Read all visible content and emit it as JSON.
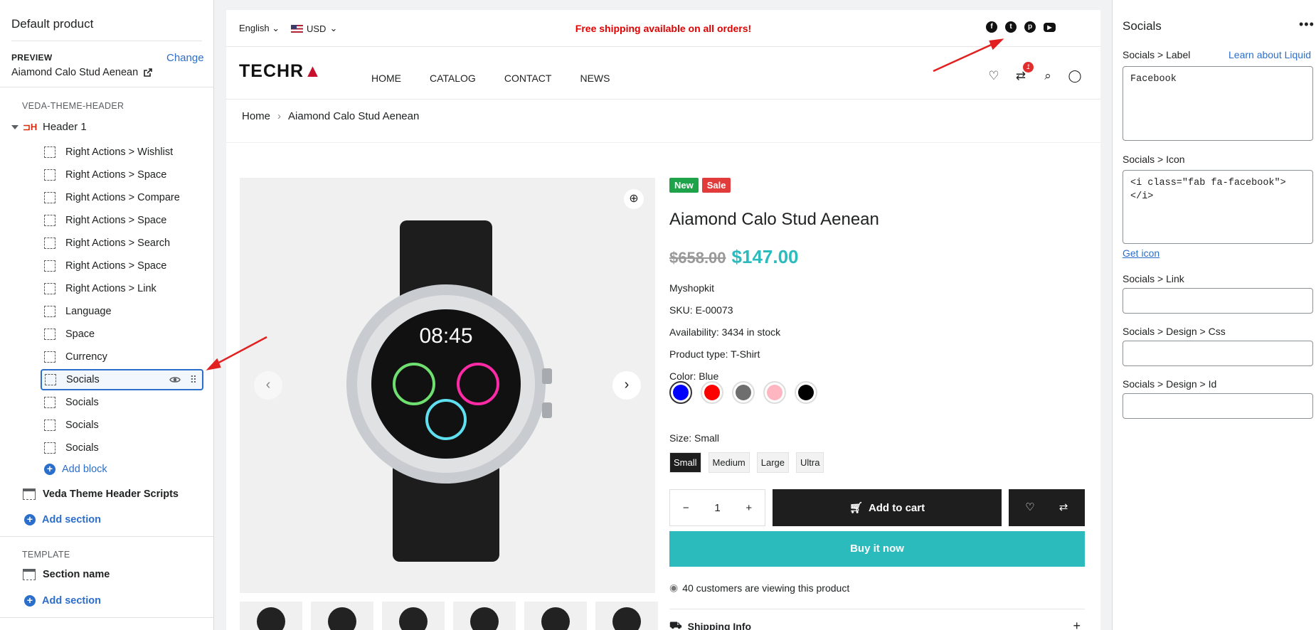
{
  "left": {
    "title": "Default product",
    "preview_label": "PREVIEW",
    "change_label": "Change",
    "preview_product": "Aiamond Calo Stud Aenean",
    "group_label": "VEDA-THEME-HEADER",
    "header_label": "Header 1",
    "blocks": [
      "Right Actions > Wishlist",
      "Right Actions > Space",
      "Right Actions > Compare",
      "Right Actions > Space",
      "Right Actions > Search",
      "Right Actions > Space",
      "Right Actions > Link",
      "Language",
      "Space",
      "Currency",
      "Socials",
      "Socials",
      "Socials",
      "Socials"
    ],
    "add_block": "Add block",
    "scripts_section": "Veda Theme Header Scripts",
    "add_section": "Add section",
    "template_label": "TEMPLATE",
    "section_name": "Section name"
  },
  "store": {
    "language": "English",
    "currency": "USD",
    "promo": "Free shipping available on all orders!",
    "social_icons": [
      "facebook-icon",
      "twitter-icon",
      "pinterest-icon",
      "youtube-icon"
    ],
    "logo": "TECHR",
    "menu": [
      "HOME",
      "CATALOG",
      "CONTACT",
      "NEWS"
    ],
    "compare_badge": "1",
    "breadcrumb": [
      "Home",
      "Aiamond Calo Stud Aenean"
    ],
    "product": {
      "badge_new": "New",
      "badge_sale": "Sale",
      "name": "Aiamond Calo Stud Aenean",
      "old_price": "$658.00",
      "price": "$147.00",
      "vendor": "Myshopkit",
      "sku": "SKU: E-00073",
      "availability": "Availability: 3434 in stock",
      "type": "Product type: T-Shirt",
      "color_label": "Color: Blue",
      "colors": [
        "#0000ff",
        "#ff0000",
        "#6e6e6e",
        "#ffb6c1",
        "#000000"
      ],
      "size_label": "Size: Small",
      "sizes": [
        "Small",
        "Medium",
        "Large",
        "Ultra"
      ],
      "qty": "1",
      "add_to_cart": "Add to cart",
      "buy_now": "Buy it now",
      "viewers": "40 customers are viewing this product",
      "shipping": "Shipping Info"
    }
  },
  "right": {
    "title": "Socials",
    "label_field": "Socials > Label",
    "learn_link": "Learn about Liquid",
    "label_value": "Facebook",
    "icon_field": "Socials > Icon",
    "icon_value": "<i class=\"fab fa-facebook\">\n</i>",
    "get_icon": "Get icon",
    "link_field": "Socials > Link",
    "css_field": "Socials > Design > Css",
    "id_field": "Socials > Design > Id"
  }
}
